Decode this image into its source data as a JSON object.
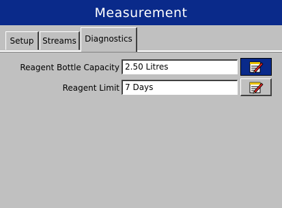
{
  "window": {
    "title": "Measurement"
  },
  "tabs": [
    {
      "label": "Setup",
      "active": false
    },
    {
      "label": "Streams",
      "active": false
    },
    {
      "label": "Diagnostics",
      "active": true
    }
  ],
  "fields": [
    {
      "label": "Reagent Bottle Capacity",
      "value": "2.50 Litres",
      "edit_icon": "edit-notepad-icon"
    },
    {
      "label": "Reagent Limit",
      "value": "7 Days",
      "edit_icon": "edit-notepad-icon"
    }
  ],
  "colors": {
    "titlebar_bg": "#0a2a8a",
    "titlebar_text": "#ffffff",
    "panel_bg": "#c0c0c0",
    "selected_button_bg": "#0a2a8a"
  }
}
